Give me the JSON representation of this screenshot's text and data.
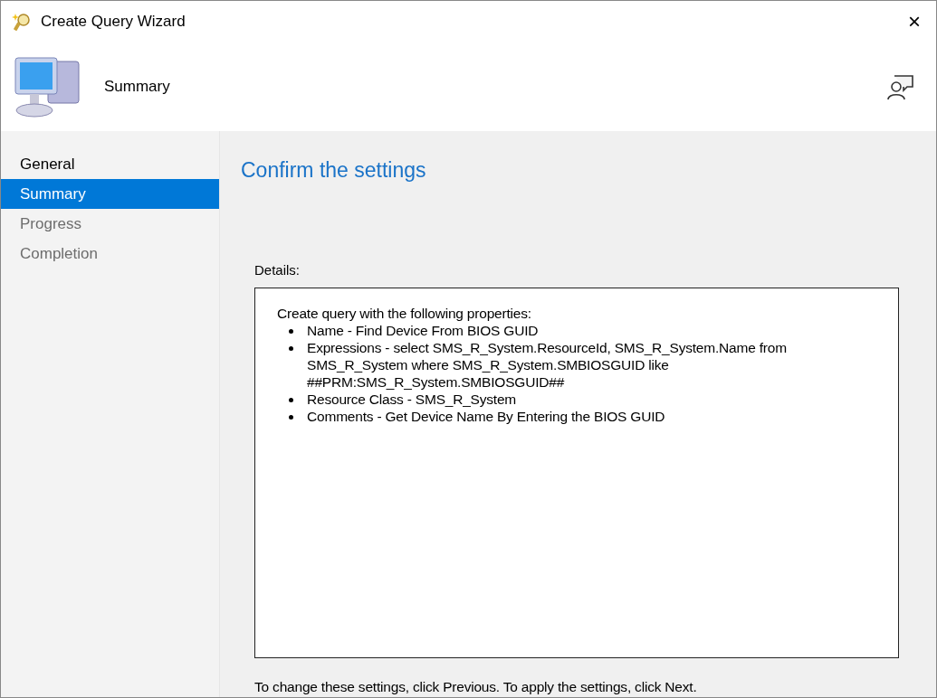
{
  "window": {
    "title": "Create Query Wizard",
    "close": "×"
  },
  "header": {
    "title": "Summary"
  },
  "nav": [
    {
      "label": "General",
      "selected": false,
      "disabled": false
    },
    {
      "label": "Summary",
      "selected": true,
      "disabled": false
    },
    {
      "label": "Progress",
      "selected": false,
      "disabled": true
    },
    {
      "label": "Completion",
      "selected": false,
      "disabled": true
    }
  ],
  "page": {
    "heading": "Confirm the settings",
    "details_label": "Details:",
    "intro": "Create query with the following properties:",
    "properties": [
      "Name - Find Device From BIOS GUID",
      "Expressions - select SMS_R_System.ResourceId, SMS_R_System.Name from SMS_R_System where SMS_R_System.SMBIOSGUID like ##PRM:SMS_R_System.SMBIOSGUID##",
      "Resource Class - SMS_R_System",
      "Comments - Get Device Name By Entering the BIOS GUID"
    ],
    "footer": "To change these settings, click Previous. To apply the settings, click Next."
  }
}
